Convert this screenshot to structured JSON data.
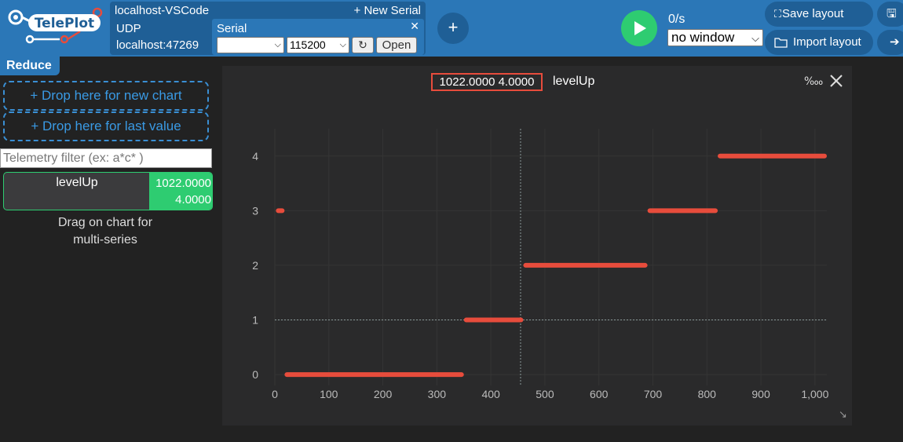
{
  "header": {
    "logo_text": "TelePlot",
    "connection_title": "localhost-VSCode",
    "connection_type": "UDP",
    "connection_address": "localhost:47269",
    "new_serial_label": "+ New Serial",
    "serial_label": "Serial",
    "serial_close": "✕",
    "port_value": "",
    "baud_value": "115200",
    "refresh_label": "↻",
    "open_label": "Open",
    "add_label": "+",
    "rate_label": "0/s",
    "window_select_value": "no window",
    "save_layout_label": "Save layout",
    "import_layout_label": "Import layout"
  },
  "sidebar": {
    "reduce_label": "Reduce",
    "drop_new_chart": "+ Drop here for new chart",
    "drop_last_value": "+ Drop here for last value",
    "filter_placeholder": "Telemetry filter (ex: a*c* )",
    "telemetry": [
      {
        "name": "levelUp",
        "value_x": "1022.0000",
        "value_y": "4.0000"
      }
    ],
    "drag_hint_line1": "Drag on chart for",
    "drag_hint_line2": "multi-series"
  },
  "chart_panel": {
    "cursor_readout": "1022.0000 4.0000",
    "series_label": "levelUp",
    "permil_label": "‱",
    "accent_color": "#e74c3c"
  },
  "chart_data": {
    "type": "line",
    "series": [
      {
        "name": "levelUp",
        "segments": [
          {
            "x_start": 2,
            "x_end": 18,
            "y": 3
          },
          {
            "x_start": 18,
            "x_end": 350,
            "y": 0
          },
          {
            "x_start": 350,
            "x_end": 460,
            "y": 1
          },
          {
            "x_start": 460,
            "x_end": 690,
            "y": 2
          },
          {
            "x_start": 690,
            "x_end": 820,
            "y": 3
          },
          {
            "x_start": 820,
            "x_end": 1022,
            "y": 4
          }
        ]
      }
    ],
    "xlim": [
      0,
      1022
    ],
    "ylim": [
      -0.2,
      4.5
    ],
    "x_ticks": [
      0,
      100,
      200,
      300,
      400,
      500,
      600,
      700,
      800,
      900,
      1000
    ],
    "x_tick_labels": [
      "0",
      "100",
      "200",
      "300",
      "400",
      "500",
      "600",
      "700",
      "800",
      "900",
      "1,000"
    ],
    "y_ticks": [
      0,
      1,
      2,
      3,
      4
    ],
    "y_tick_labels": [
      "0",
      "1",
      "2",
      "3",
      "4"
    ],
    "cursor": {
      "x": 455,
      "y": 1
    },
    "grid": true,
    "title": "",
    "xlabel": "",
    "ylabel": ""
  }
}
